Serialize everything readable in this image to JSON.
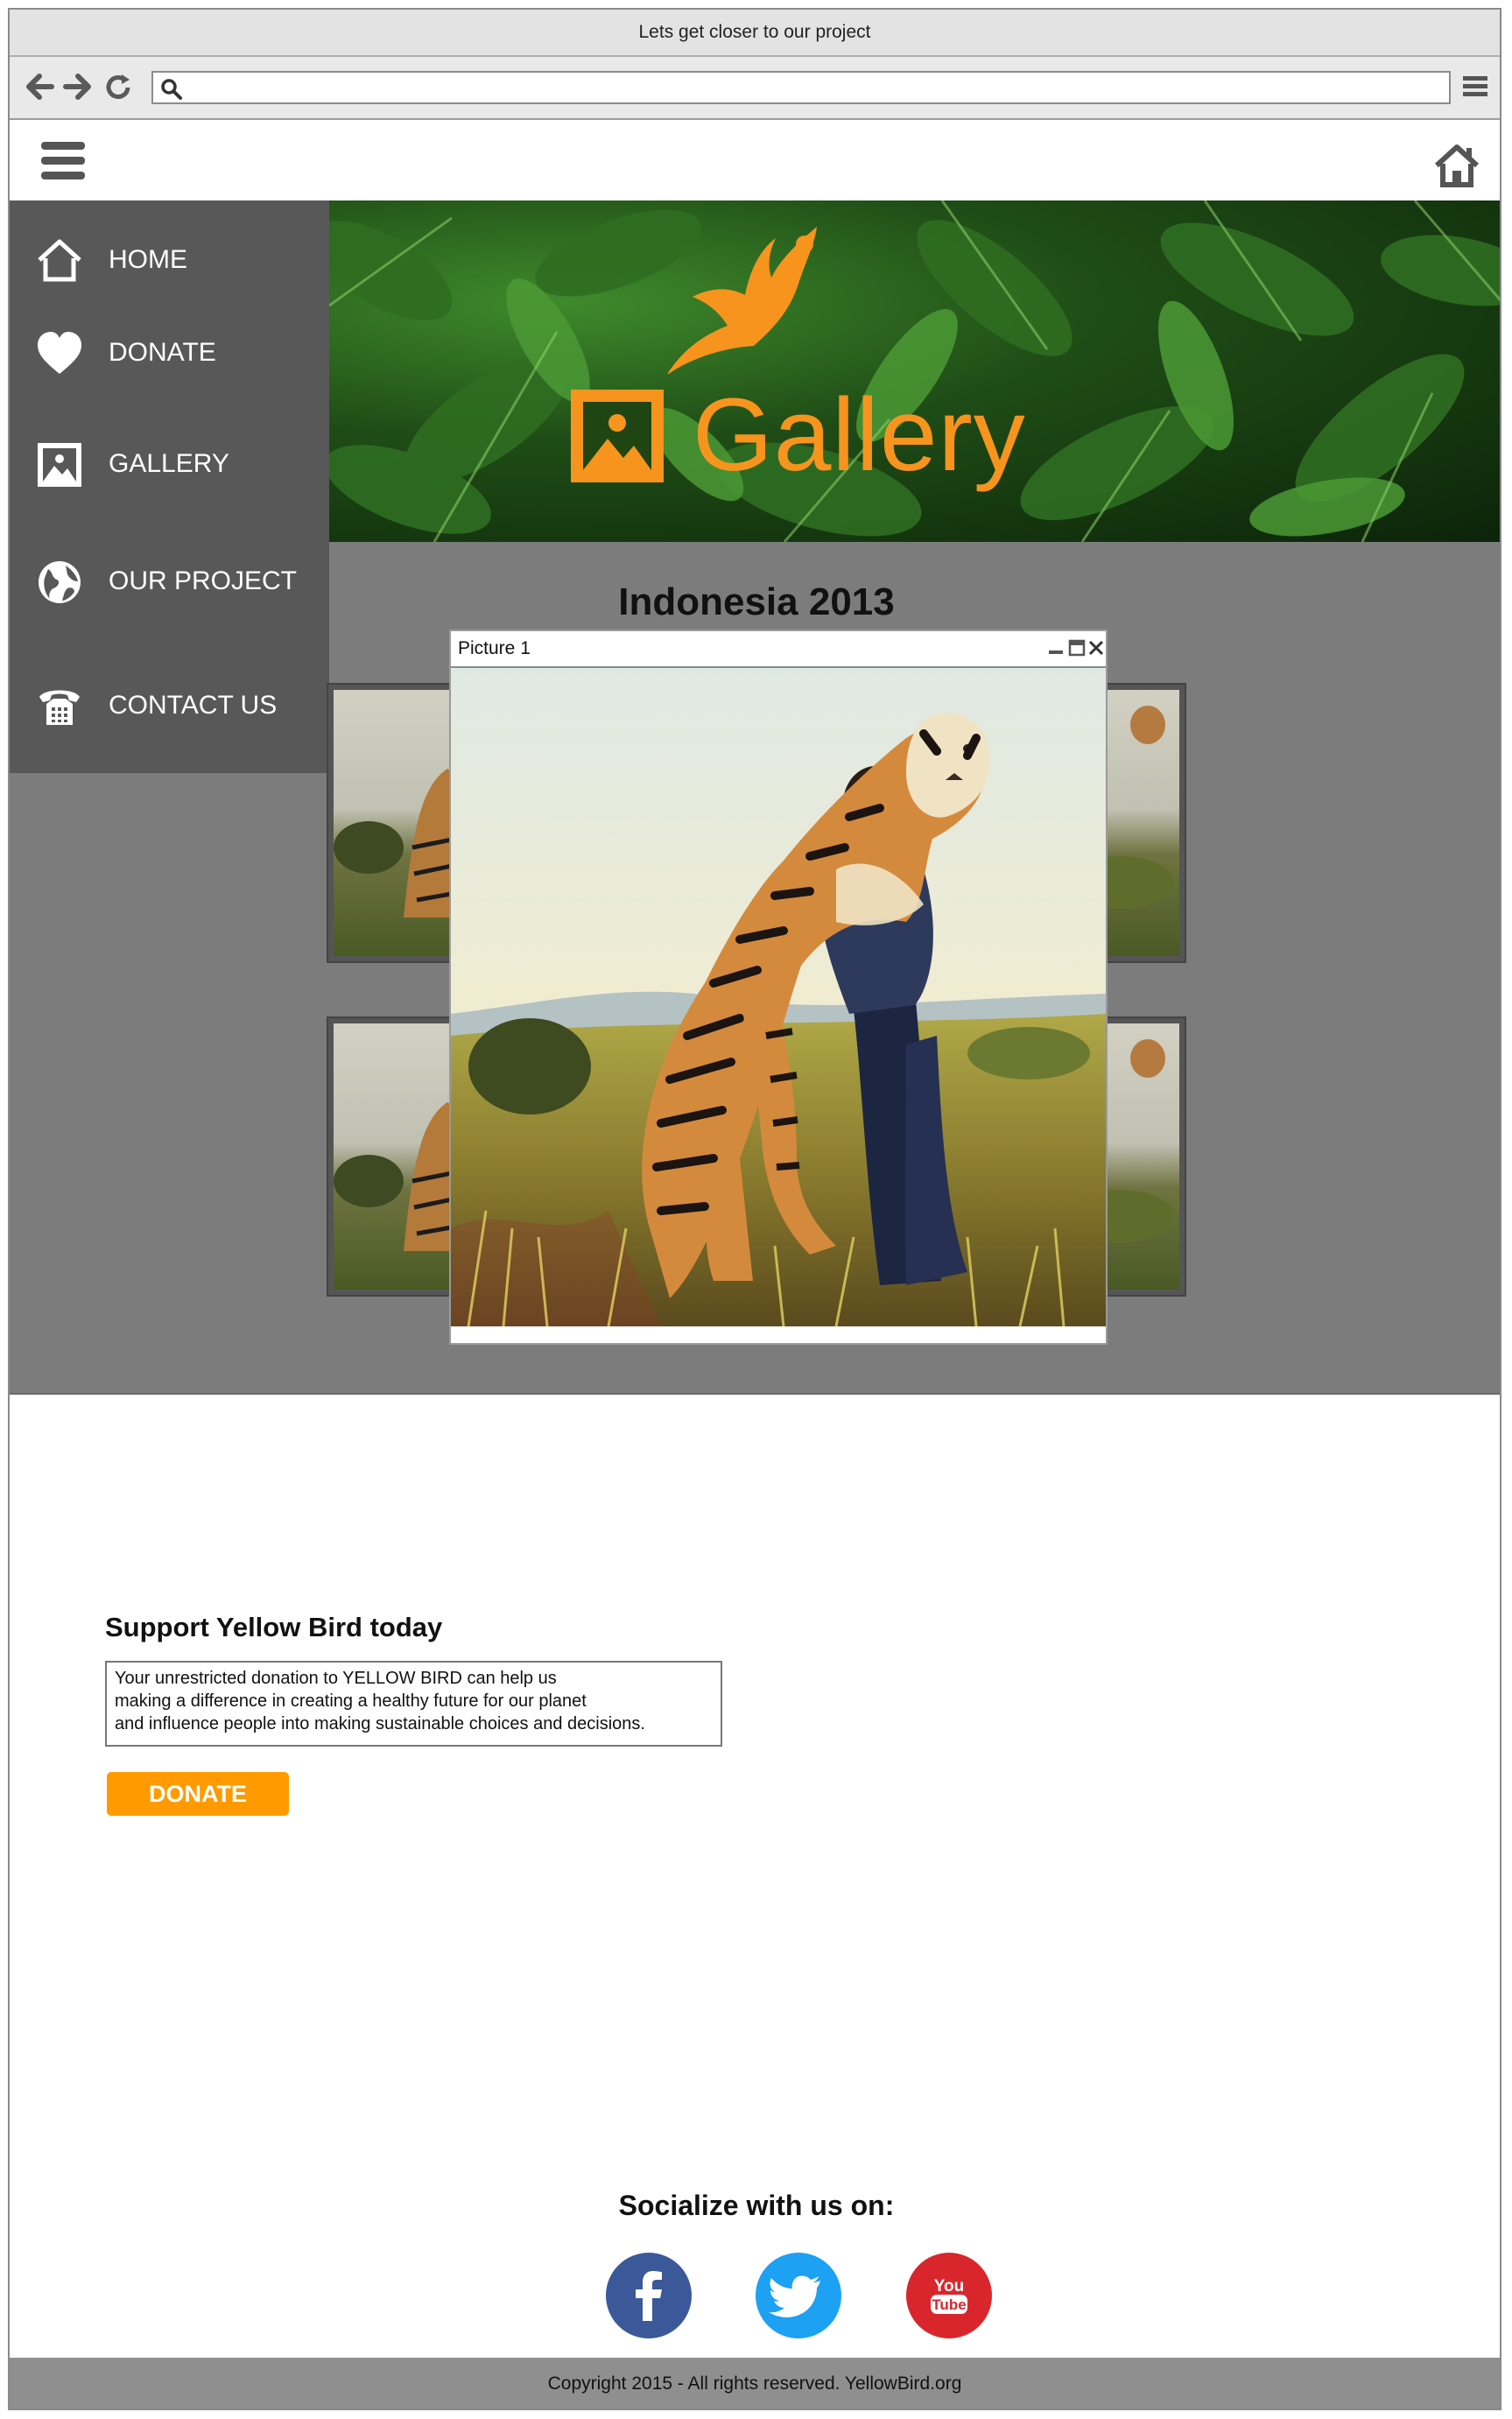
{
  "browser": {
    "window_title": "Lets get closer to our project",
    "url": ""
  },
  "sidebar": {
    "items": [
      {
        "label": "HOME",
        "icon": "home-icon"
      },
      {
        "label": "DONATE",
        "icon": "heart-icon"
      },
      {
        "label": "GALLERY",
        "icon": "image-icon"
      },
      {
        "label": "OUR PROJECT",
        "icon": "globe-icon"
      },
      {
        "label": "CONTACT US",
        "icon": "telephone-icon"
      }
    ]
  },
  "banner": {
    "title": "Gallery",
    "logo": "bird-logo",
    "accent_color": "#f7941d"
  },
  "gallery": {
    "heading": "Indonesia 2013"
  },
  "modal": {
    "title": "Picture 1"
  },
  "support": {
    "title": "Support Yellow Bird today",
    "text_lines": [
      "Your unrestricted donation to YELLOW BIRD can help us",
      "making a difference in creating a healthy future for our planet",
      "and influence people into making sustainable choices and decisions."
    ],
    "button_label": "DONATE",
    "button_color": "#ff9b00"
  },
  "social": {
    "heading": "Socialize with us on:",
    "networks": [
      {
        "name": "facebook",
        "icon": "facebook-icon",
        "color": "#3b5998"
      },
      {
        "name": "twitter",
        "icon": "twitter-icon",
        "color": "#1da1f2"
      },
      {
        "name": "youtube",
        "icon": "youtube-icon",
        "color": "#d9262c",
        "logo_text_1": "You",
        "logo_text_2": "Tube"
      }
    ]
  },
  "footer": {
    "copyright": "Copyright 2015  - All rights reserved. YellowBird.org"
  }
}
